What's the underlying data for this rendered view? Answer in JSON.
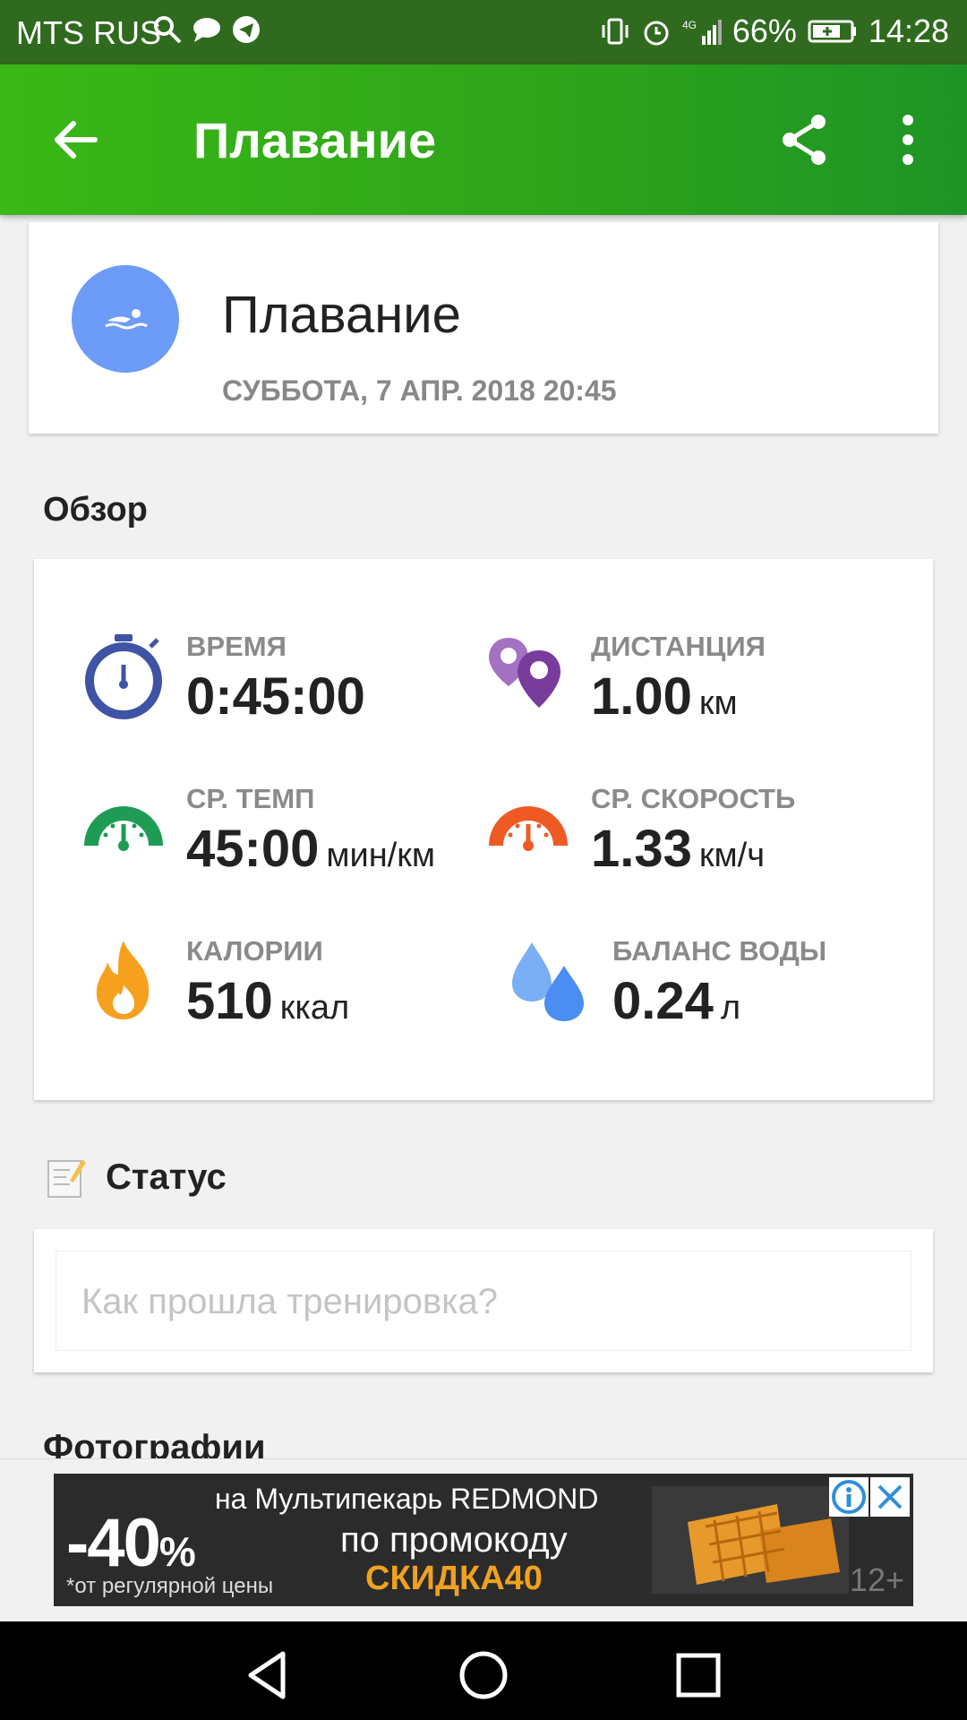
{
  "status_bar": {
    "carrier": "MTS RUS",
    "battery": "66%",
    "time": "14:28",
    "network": "4G",
    "icons": [
      "search-icon",
      "chat-icon",
      "telegram-icon",
      "vibrate-icon",
      "alarm-icon",
      "signal-icon",
      "battery-icon"
    ]
  },
  "app_bar": {
    "title": "Плавание",
    "back_icon": "arrow-left-icon",
    "share_icon": "share-icon",
    "more_icon": "more-vert-icon"
  },
  "workout": {
    "name": "Плавание",
    "datetime": "СУББОТА, 7 АПР. 2018 20:45",
    "icon": "swimmer-icon",
    "icon_bg": "#6d9bf8"
  },
  "overview": {
    "title": "Обзор",
    "stats": [
      {
        "label": "ВРЕМЯ",
        "value": "0:45:00",
        "unit": "",
        "icon": "stopwatch-icon",
        "color": "#3f54a4"
      },
      {
        "label": "ДИСТАНЦИЯ",
        "value": "1.00",
        "unit": "км",
        "icon": "map-pins-icon",
        "color": "#7a3c9c"
      },
      {
        "label": "СР. ТЕМП",
        "value": "45:00",
        "unit": "мин/км",
        "icon": "pace-gauge-icon",
        "color": "#1e9b55"
      },
      {
        "label": "СР. СКОРОСТЬ",
        "value": "1.33",
        "unit": "км/ч",
        "icon": "speed-gauge-icon",
        "color": "#ef5a24"
      },
      {
        "label": "КАЛОРИИ",
        "value": "510",
        "unit": "ккал",
        "icon": "flame-icon",
        "color": "#f6a01e"
      },
      {
        "label": "БАЛАНС ВОДЫ",
        "value": "0.24",
        "unit": "л",
        "icon": "water-drops-icon",
        "color": "#4b8df0"
      }
    ]
  },
  "status": {
    "title": "Статус",
    "placeholder": "Как прошла тренировка?",
    "icon": "note-edit-icon"
  },
  "photos": {
    "title": "Фотографии"
  },
  "ad": {
    "discount": "-40",
    "percent": "%",
    "line1": "на Мультипекарь REDMOND",
    "line2": "по промокоду",
    "promo": "СКИДКА40",
    "footnote": "*от регулярной цены",
    "age": "12+"
  },
  "nav_bar": {
    "icons": [
      "nav-back-icon",
      "nav-home-icon",
      "nav-recents-icon"
    ]
  }
}
